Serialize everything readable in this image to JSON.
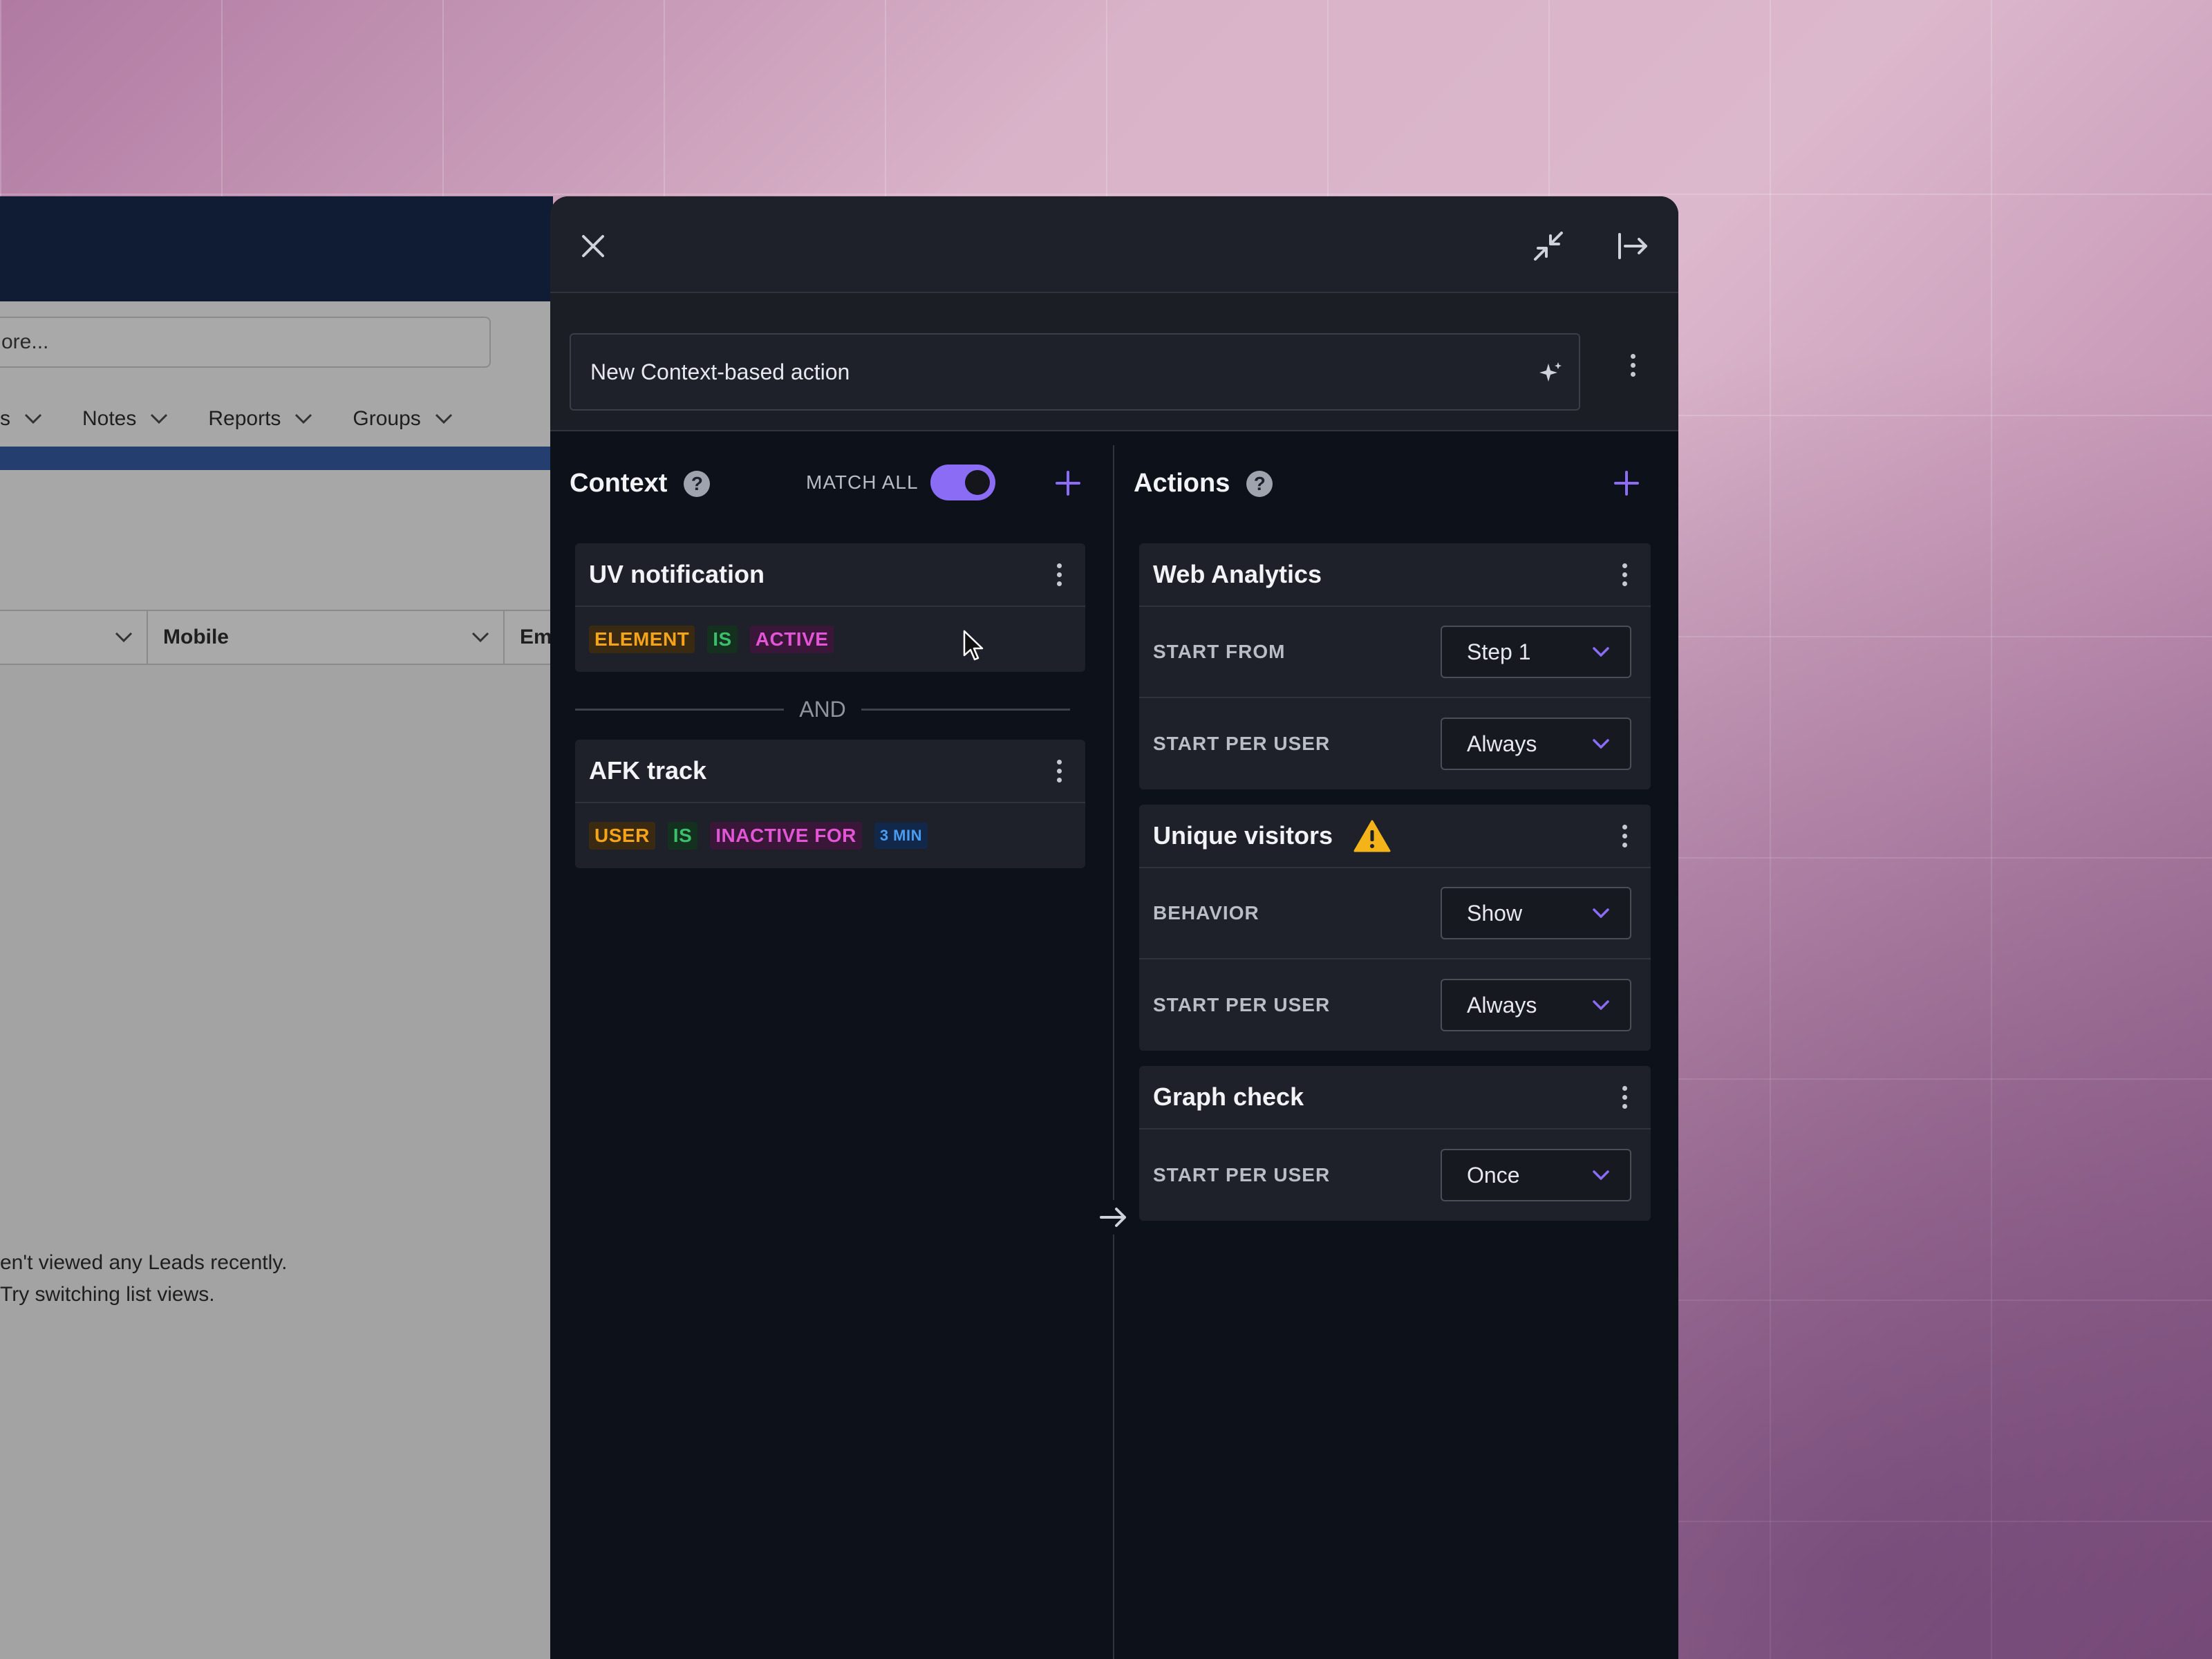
{
  "crm": {
    "search_value": "ore...",
    "nav_items": [
      "s",
      "Notes",
      "Reports",
      "Groups"
    ],
    "columns": [
      "Mobile",
      "Em"
    ],
    "empty_line1": "en't viewed any Leads recently.",
    "empty_line2": "Try switching list views."
  },
  "panel": {
    "header": {
      "close_icon": "close-icon",
      "collapse_icon": "collapse-icon",
      "dock_icon": "dock-right-icon"
    },
    "title_value": "New Context-based action",
    "context": {
      "title": "Context",
      "help": "?",
      "match_all_label": "MATCH ALL",
      "match_all_on": true,
      "and_label": "AND",
      "cards": [
        {
          "name": "UV notification",
          "chips": [
            {
              "text": "ELEMENT",
              "color": "orange"
            },
            {
              "text": "IS",
              "color": "green"
            },
            {
              "text": "ACTIVE",
              "color": "pink"
            }
          ]
        },
        {
          "name": "AFK track",
          "chips": [
            {
              "text": "USER",
              "color": "orange"
            },
            {
              "text": "IS",
              "color": "green"
            },
            {
              "text": "INACTIVE FOR",
              "color": "pink"
            },
            {
              "text": "3 MIN",
              "color": "blue"
            }
          ]
        }
      ]
    },
    "actions": {
      "title": "Actions",
      "help": "?",
      "cards": [
        {
          "name": "Web Analytics",
          "warning": false,
          "fields": [
            {
              "label": "START FROM",
              "value": "Step 1"
            },
            {
              "label": "START PER USER",
              "value": "Always"
            }
          ]
        },
        {
          "name": "Unique visitors",
          "warning": true,
          "fields": [
            {
              "label": "BEHAVIOR",
              "value": "Show"
            },
            {
              "label": "START PER USER",
              "value": "Always"
            }
          ]
        },
        {
          "name": "Graph check",
          "warning": false,
          "fields": [
            {
              "label": "START PER USER",
              "value": "Once"
            }
          ]
        }
      ]
    },
    "colors": {
      "accent": "#8b6cf5",
      "panel_bg": "#0d1119",
      "card_bg": "#1e2129",
      "warning": "#f5b31a"
    }
  }
}
